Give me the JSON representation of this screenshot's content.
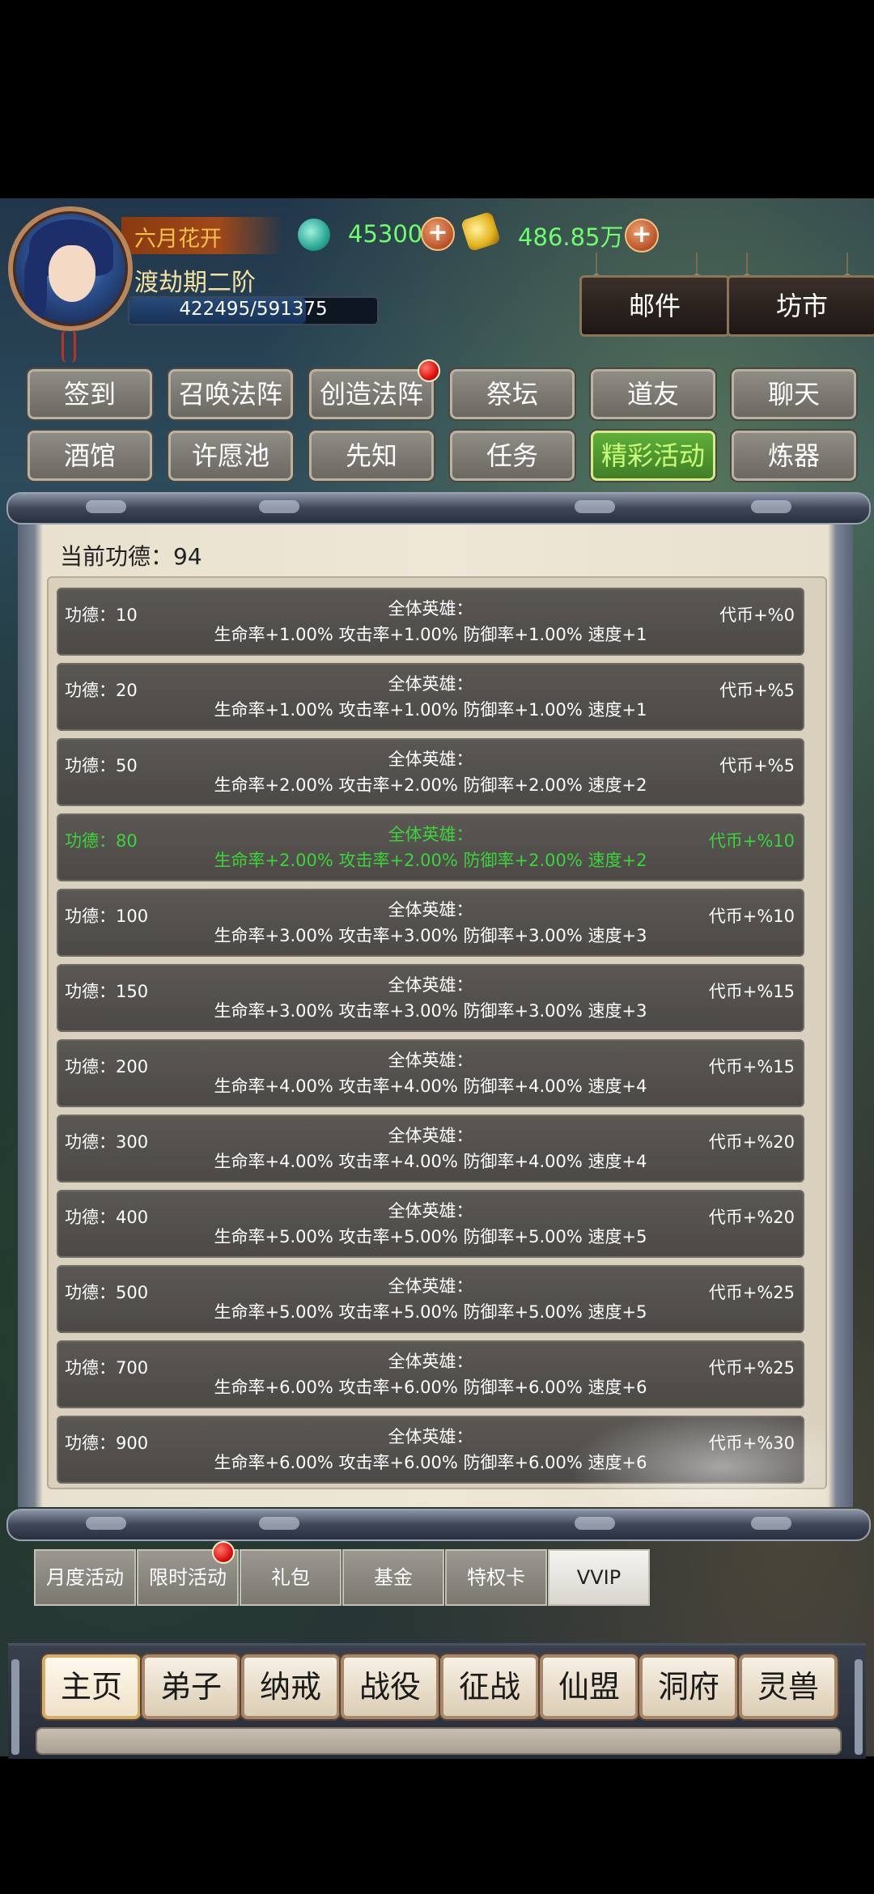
{
  "player": {
    "name": "六月花开",
    "realm": "渡劫期二阶",
    "exp_text": "422495/591375",
    "exp_fraction": 0.714
  },
  "currencies": {
    "jade_value": "45300",
    "gold_value": "486.85万",
    "jade_icon": "jade-icon",
    "gold_icon": "gold-ingot-icon"
  },
  "top_buttons": {
    "mail": "邮件",
    "market": "坊市"
  },
  "menu": [
    "签到",
    "召唤法阵",
    "创造法阵",
    "祭坛",
    "道友",
    "聊天",
    "酒馆",
    "许愿池",
    "先知",
    "任务",
    "精彩活动",
    "炼器"
  ],
  "menu_active": "精彩活动",
  "panel": {
    "current_merit": "当前功德：94",
    "rows": [
      {
        "merit": "功德：10",
        "heading": "全体英雄：",
        "bonus": "生命率+1.00% 攻击率+1.00% 防御率+1.00% 速度+1",
        "currency": "代币+%0"
      },
      {
        "merit": "功德：20",
        "heading": "全体英雄：",
        "bonus": "生命率+1.00% 攻击率+1.00% 防御率+1.00% 速度+1",
        "currency": "代币+%5"
      },
      {
        "merit": "功德：50",
        "heading": "全体英雄：",
        "bonus": "生命率+2.00% 攻击率+2.00% 防御率+2.00% 速度+2",
        "currency": "代币+%5"
      },
      {
        "merit": "功德：80",
        "heading": "全体英雄：",
        "bonus": "生命率+2.00% 攻击率+2.00% 防御率+2.00% 速度+2",
        "currency": "代币+%10"
      },
      {
        "merit": "功德：100",
        "heading": "全体英雄：",
        "bonus": "生命率+3.00% 攻击率+3.00% 防御率+3.00% 速度+3",
        "currency": "代币+%10"
      },
      {
        "merit": "功德：150",
        "heading": "全体英雄：",
        "bonus": "生命率+3.00% 攻击率+3.00% 防御率+3.00% 速度+3",
        "currency": "代币+%15"
      },
      {
        "merit": "功德：200",
        "heading": "全体英雄：",
        "bonus": "生命率+4.00% 攻击率+4.00% 防御率+4.00% 速度+4",
        "currency": "代币+%15"
      },
      {
        "merit": "功德：300",
        "heading": "全体英雄：",
        "bonus": "生命率+4.00% 攻击率+4.00% 防御率+4.00% 速度+4",
        "currency": "代币+%20"
      },
      {
        "merit": "功德：400",
        "heading": "全体英雄：",
        "bonus": "生命率+5.00% 攻击率+5.00% 防御率+5.00% 速度+5",
        "currency": "代币+%20"
      },
      {
        "merit": "功德：500",
        "heading": "全体英雄：",
        "bonus": "生命率+5.00% 攻击率+5.00% 防御率+5.00% 速度+5",
        "currency": "代币+%25"
      },
      {
        "merit": "功德：700",
        "heading": "全体英雄：",
        "bonus": "生命率+6.00% 攻击率+6.00% 防御率+6.00% 速度+6",
        "currency": "代币+%25"
      },
      {
        "merit": "功德：900",
        "heading": "全体英雄：",
        "bonus": "生命率+6.00% 攻击率+6.00% 防御率+6.00% 速度+6",
        "currency": "代币+%30"
      }
    ],
    "highlighted_row": "功德：80",
    "highlight_color": "#3bd43b"
  },
  "sub_tabs": [
    "月度活动",
    "限时活动",
    "礼包",
    "基金",
    "特权卡",
    "VVIP"
  ],
  "sub_tab_active": "VVIP",
  "nav": [
    "主页",
    "弟子",
    "纳戒",
    "战役",
    "征战",
    "仙盟",
    "洞府",
    "灵兽"
  ],
  "nav_active": "主页",
  "colors": {
    "currency_green": "#6cff6c",
    "name_gold": "#f6c24a",
    "notify_red": "#dd1111"
  }
}
